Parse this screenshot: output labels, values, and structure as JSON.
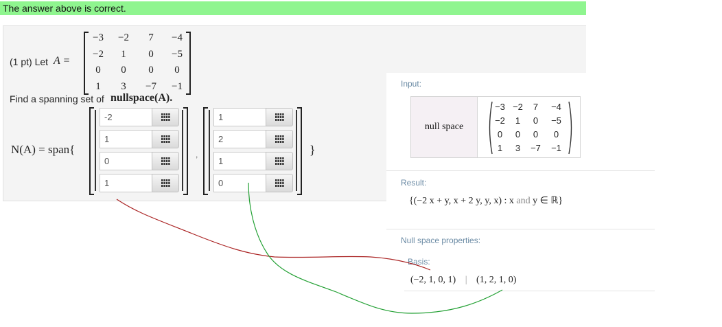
{
  "banner": {
    "text": "The answer above is correct."
  },
  "problem": {
    "points": "(1 pt) Let",
    "matrix_name": "A =",
    "matrix": [
      [
        "−3",
        "−2",
        "7",
        "−4"
      ],
      [
        "−2",
        "1",
        "0",
        "−5"
      ],
      [
        "0",
        "0",
        "0",
        "0"
      ],
      [
        "1",
        "3",
        "−7",
        "−1"
      ]
    ],
    "prompt_prefix": "Find a spanning set of",
    "prompt_math": "nullspace(A).",
    "lhs": "N(A) = span{",
    "comma": ",",
    "close": "}",
    "vector1": [
      "-2",
      "1",
      "0",
      "1"
    ],
    "vector2": [
      "1",
      "2",
      "1",
      "0"
    ]
  },
  "wolfram": {
    "input_label": "Input:",
    "command": "null space",
    "matrix": [
      [
        "−3",
        "−2",
        "7",
        "−4"
      ],
      [
        "−2",
        "1",
        "0",
        "−5"
      ],
      [
        "0",
        "0",
        "0",
        "0"
      ],
      [
        "1",
        "3",
        "−7",
        "−1"
      ]
    ],
    "result_label": "Result:",
    "result_prefix": "{(−2 x + y, x + 2 y, y, x) : x",
    "result_and": "and",
    "result_suffix": "y ∈ ℝ}",
    "props_label": "Null space properties:",
    "basis_label": "Basis:",
    "basis_v1": "(−2, 1, 0, 1)",
    "basis_sep": "|",
    "basis_v2": "(1, 2, 1, 0)"
  },
  "annotations": {
    "line1_color": "#aa2222",
    "line2_color": "#22a033"
  },
  "icons": {
    "matrix_button": "grid-icon"
  }
}
